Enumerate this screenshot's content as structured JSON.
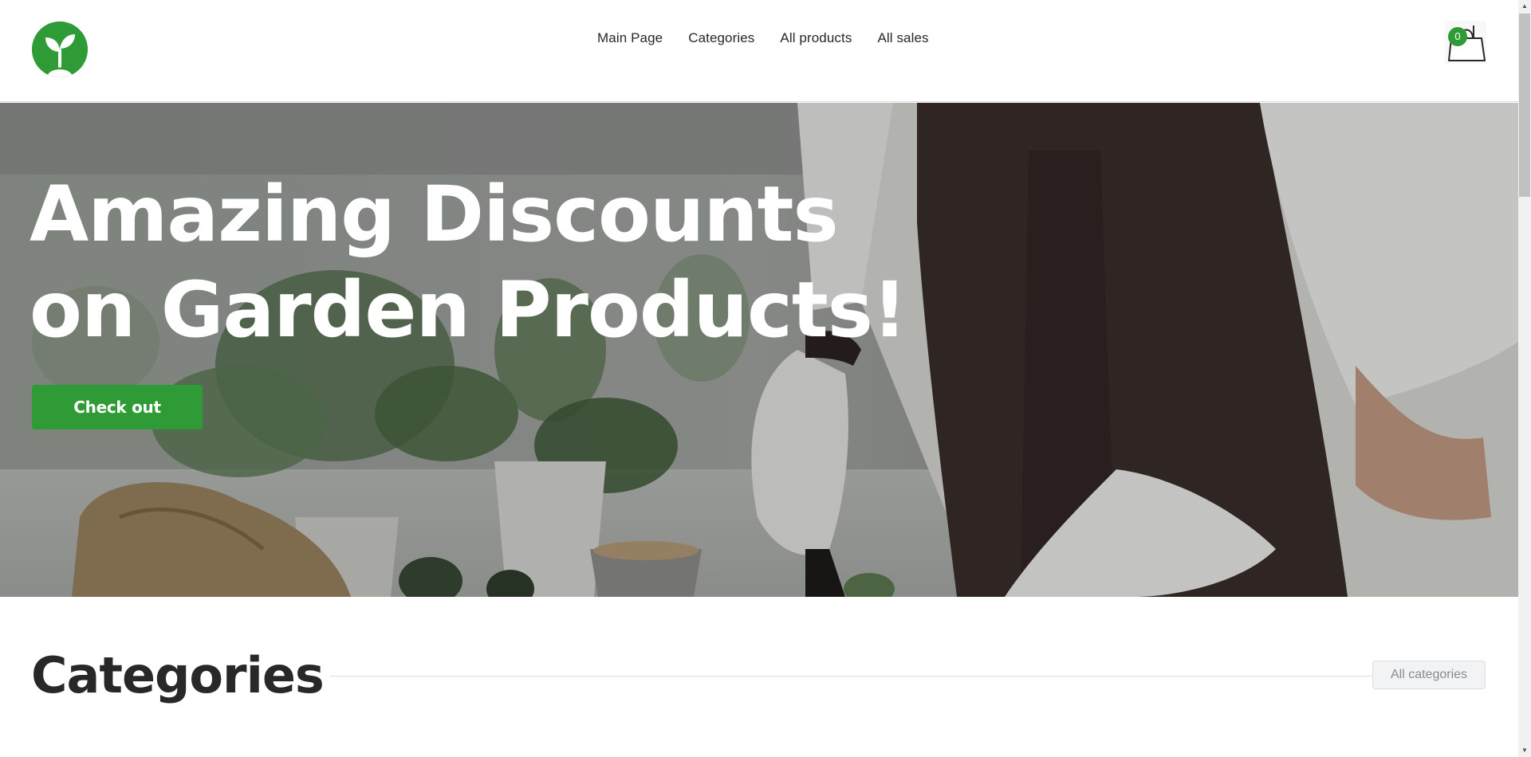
{
  "header": {
    "logo_icon": "sprout-icon",
    "nav": [
      {
        "label": "Main Page"
      },
      {
        "label": "Categories"
      },
      {
        "label": "All products"
      },
      {
        "label": "All sales"
      }
    ],
    "cart": {
      "icon": "shopping-bag-icon",
      "count": "0"
    }
  },
  "hero": {
    "title_line1": "Amazing Discounts",
    "title_line2": "on Garden Products!",
    "cta_label": "Check out"
  },
  "categories": {
    "title": "Categories",
    "all_button_label": "All categories"
  },
  "colors": {
    "accent": "#2f9b37",
    "text": "#282828",
    "muted": "#8b8b8b",
    "divider": "#dddddd"
  }
}
